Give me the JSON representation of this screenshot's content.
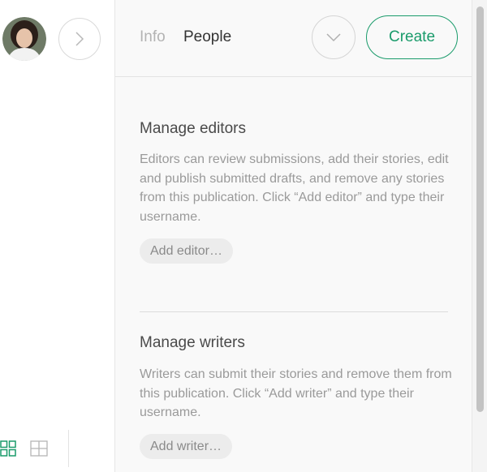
{
  "header": {
    "tabs": [
      {
        "label": "Info",
        "active": false
      },
      {
        "label": "People",
        "active": true
      }
    ],
    "create_label": "Create"
  },
  "sections": {
    "editors": {
      "title": "Manage editors",
      "description": "Editors can review submissions, add their stories, edit and publish submitted drafts, and remove any stories from this publication. Click “Add editor” and type their username.",
      "button_label": "Add editor…"
    },
    "writers": {
      "title": "Manage writers",
      "description": "Writers can submit their stories and remove them from this publication. Click “Add writer” and type their username.",
      "button_label": "Add writer…"
    }
  },
  "icons": {
    "next": "chevron-right-icon",
    "dropdown": "chevron-down-icon",
    "grid_large": "grid-icon",
    "grid_small": "table-icon"
  },
  "colors": {
    "accent": "#1a9b6b",
    "panel_bg": "#f9f9f9"
  }
}
